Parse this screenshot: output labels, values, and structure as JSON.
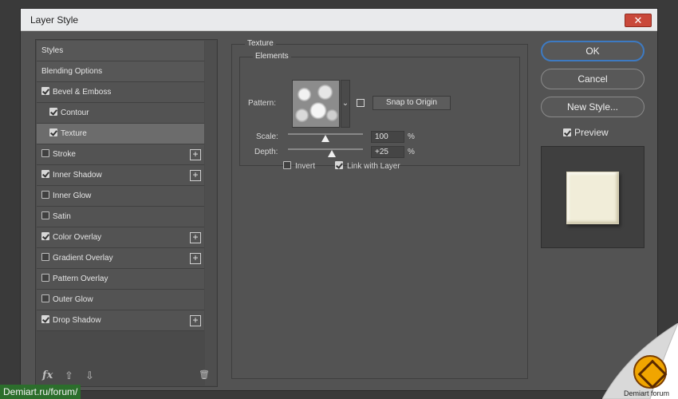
{
  "window": {
    "title": "Layer Style",
    "close_glyph": "✕"
  },
  "styles_list": {
    "items": [
      {
        "label": "Styles",
        "kind": "header"
      },
      {
        "label": "Blending Options",
        "kind": "header"
      },
      {
        "label": "Bevel & Emboss",
        "checked": true,
        "plus": false
      },
      {
        "label": "Contour",
        "checked": true,
        "plus": false,
        "indent": true
      },
      {
        "label": "Texture",
        "checked": true,
        "plus": false,
        "indent": true,
        "selected": true
      },
      {
        "label": "Stroke",
        "checked": false,
        "plus": true
      },
      {
        "label": "Inner Shadow",
        "checked": true,
        "plus": true
      },
      {
        "label": "Inner Glow",
        "checked": false,
        "plus": false
      },
      {
        "label": "Satin",
        "checked": false,
        "plus": false
      },
      {
        "label": "Color Overlay",
        "checked": true,
        "plus": true
      },
      {
        "label": "Gradient Overlay",
        "checked": false,
        "plus": true
      },
      {
        "label": "Pattern Overlay",
        "checked": false,
        "plus": false
      },
      {
        "label": "Outer Glow",
        "checked": false,
        "plus": false
      },
      {
        "label": "Drop Shadow",
        "checked": true,
        "plus": true
      }
    ],
    "footer": {
      "fx": "fx",
      "up": "⇧",
      "down": "⇩",
      "trash": "🗑"
    }
  },
  "texture": {
    "group_title": "Texture",
    "subgroup_title": "Elements",
    "pattern_label": "Pattern:",
    "snap_button": "Snap to Origin",
    "scale_label": "Scale:",
    "scale_value": "100",
    "scale_unit": "%",
    "scale_slider_fraction": 0.5,
    "depth_label": "Depth:",
    "depth_value": "+25",
    "depth_unit": "%",
    "depth_slider_fraction": 0.58,
    "invert_label": "Invert",
    "invert_checked": false,
    "link_label": "Link with Layer",
    "link_checked": true,
    "dropdown_glyph": "⌄"
  },
  "right_panel": {
    "ok": "OK",
    "cancel": "Cancel",
    "new_style": "New Style...",
    "preview_label": "Preview",
    "preview_checked": true
  },
  "watermark": {
    "url_text": "Demiart.ru/forum/",
    "caption": "Demiart forum"
  }
}
